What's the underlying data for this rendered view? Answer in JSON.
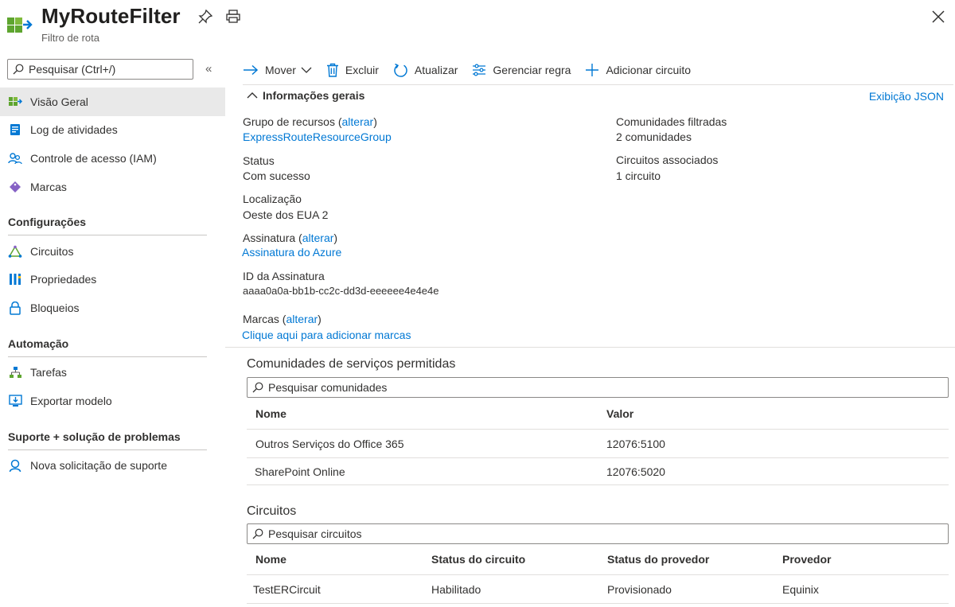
{
  "header": {
    "title": "MyRouteFilter",
    "subtitle": "Filtro de rota"
  },
  "sidebar": {
    "search_placeholder": "Pesquisar (Ctrl+/)",
    "collapse_glyph": "«",
    "items": [
      {
        "label": "Visão Geral",
        "icon": "overview-icon"
      },
      {
        "label": "Log de atividades",
        "icon": "activity-log-icon"
      },
      {
        "label": "Controle de acesso (IAM)",
        "icon": "access-control-icon"
      },
      {
        "label": "Marcas",
        "icon": "tag-icon"
      }
    ],
    "sections": [
      {
        "title": "Configurações",
        "items": [
          {
            "label": "Circuitos",
            "icon": "circuits-icon"
          },
          {
            "label": "Propriedades",
            "icon": "properties-icon"
          },
          {
            "label": "Bloqueios",
            "icon": "lock-icon"
          }
        ]
      },
      {
        "title": "Automação",
        "items": [
          {
            "label": "Tarefas",
            "icon": "tasks-icon"
          },
          {
            "label": "Exportar modelo",
            "icon": "export-template-icon"
          }
        ]
      },
      {
        "title": "Suporte + solução de problemas",
        "items": [
          {
            "label": "Nova solicitação de suporte",
            "icon": "support-request-icon"
          }
        ]
      }
    ]
  },
  "toolbar": {
    "move": "Mover",
    "delete": "Excluir",
    "refresh": "Atualizar",
    "manage_rule": "Gerenciar regra",
    "add_circuit": "Adicionar circuito"
  },
  "essentials": {
    "toggle_label": "Informações gerais",
    "json_view": "Exibição JSON",
    "change_label": "alterar",
    "resource_group_label": "Grupo de recursos",
    "resource_group_value": "ExpressRouteResourceGroup",
    "status_label": "Status",
    "status_value": "Com sucesso",
    "location_label": "Localização",
    "location_value": "Oeste dos EUA 2",
    "subscription_label": "Assinatura",
    "subscription_value": "Assinatura do Azure",
    "subscription_id_label": "ID da Assinatura",
    "subscription_id_value": "aaaa0a0a-bb1b-cc2c-dd3d-eeeeee4e4e4e",
    "tags_label": "Marcas",
    "tags_value": "Clique aqui para adicionar marcas",
    "filtered_label": "Comunidades filtradas",
    "filtered_value": "2 comunidades",
    "circuits_label": "Circuitos associados",
    "circuits_value": "1 circuito"
  },
  "communities": {
    "title": "Comunidades de serviços permitidas",
    "search_placeholder": "Pesquisar comunidades",
    "columns": [
      "Nome",
      "Valor"
    ],
    "rows": [
      [
        "Outros Serviços do Office 365",
        "12076:5100"
      ],
      [
        "SharePoint Online",
        "12076:5020"
      ]
    ]
  },
  "circuits": {
    "title": "Circuitos",
    "search_placeholder": "Pesquisar circuitos",
    "columns": [
      "Nome",
      "Status do circuito",
      "Status do provedor",
      "Provedor"
    ],
    "rows": [
      [
        "TestERCircuit",
        "Habilitado",
        "Provisionado",
        "Equinix"
      ]
    ]
  },
  "colors": {
    "link": "#0078d4",
    "active_nav": "#e9e9e9",
    "text": "#323130"
  }
}
